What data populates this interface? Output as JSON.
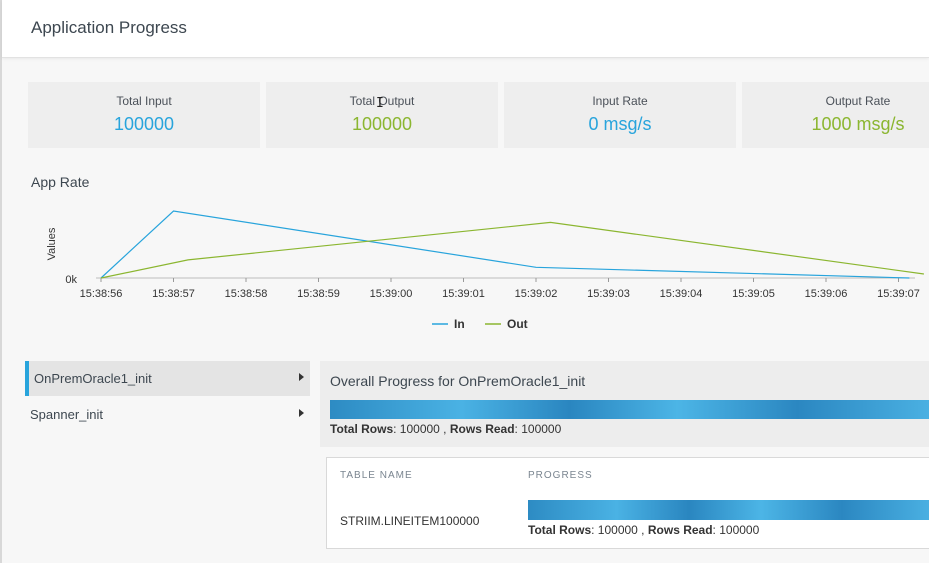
{
  "header": {
    "title": "Application Progress"
  },
  "stats": [
    {
      "label": "Total Input",
      "value": "100000",
      "color": "#28a4dc"
    },
    {
      "label": "Total Output",
      "value": "100000",
      "color": "#8bb630"
    },
    {
      "label": "Input Rate",
      "value": "0 msg/s",
      "color": "#28a4dc"
    },
    {
      "label": "Output Rate",
      "value": "1000 msg/s",
      "color": "#8bb630"
    }
  ],
  "app_rate": {
    "title": "App Rate"
  },
  "chart_data": {
    "type": "line",
    "ylabel": "Values",
    "y_tick_labels": [
      "0k"
    ],
    "x": [
      "15:38:56",
      "15:38:57",
      "15:38:58",
      "15:38:59",
      "15:39:00",
      "15:39:01",
      "15:39:02",
      "15:39:03",
      "15:39:04",
      "15:39:05",
      "15:39:06",
      "15:39:07"
    ],
    "series": [
      {
        "name": "In",
        "color": "#28a4dc",
        "points": [
          [
            0,
            0
          ],
          [
            1,
            1000
          ],
          [
            6,
            160
          ],
          [
            11.15,
            0
          ]
        ]
      },
      {
        "name": "Out",
        "color": "#8bb630",
        "points": [
          [
            0,
            0
          ],
          [
            1.2,
            270
          ],
          [
            6.2,
            830
          ],
          [
            11.35,
            60
          ]
        ]
      }
    ],
    "ylim": [
      0,
      1000
    ],
    "legend": "bottom-center",
    "grid": false
  },
  "sidebar": {
    "items": [
      {
        "label": "OnPremOracle1_init",
        "active": true
      },
      {
        "label": "Spanner_init",
        "active": false
      }
    ]
  },
  "overall": {
    "title": "Overall Progress for OnPremOracle1_init",
    "progress": 1.0,
    "total_rows_label": "Total Rows",
    "total_rows": "100000",
    "rows_read_label": "Rows Read",
    "rows_read": "100000"
  },
  "table": {
    "columns": [
      "TABLE NAME",
      "PROGRESS"
    ],
    "rows": [
      {
        "name": "STRIIM.LINEITEM100000",
        "progress": 1.0,
        "total_rows_label": "Total Rows",
        "total_rows": "100000",
        "rows_read_label": "Rows Read",
        "rows_read": "100000"
      }
    ]
  }
}
